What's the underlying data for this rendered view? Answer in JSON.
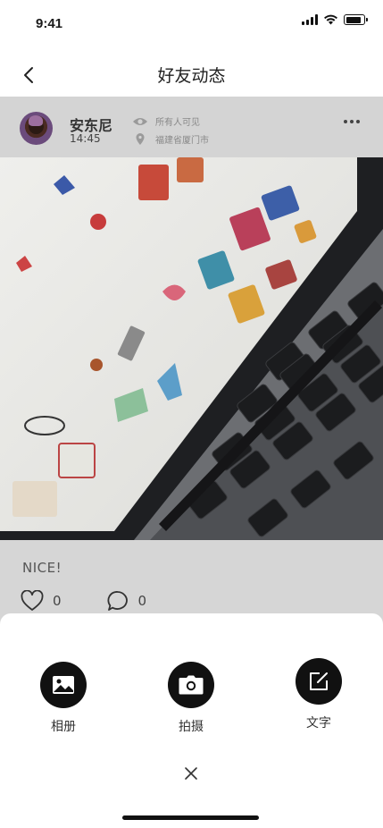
{
  "status_bar": {
    "time": "9:41",
    "battery_level": 0.85
  },
  "nav": {
    "title": "好友动态",
    "back_icon": "chevron-left-icon"
  },
  "post": {
    "author": "安东尼",
    "time": "14:45",
    "visibility": "所有人可见",
    "location": "福建省厦门市",
    "caption": "NICE!",
    "like_count": "0",
    "comment_count": "0",
    "image_description_icon": "photo"
  },
  "sheet": {
    "options": [
      {
        "label": "相册",
        "icon": "image-icon"
      },
      {
        "label": "拍摄",
        "icon": "camera-icon"
      },
      {
        "label": "文字",
        "icon": "edit-icon"
      }
    ],
    "close_icon": "close-icon"
  },
  "colors": {
    "overlay_dim": "#d6d6d6",
    "sheet_icon_bg": "#111111",
    "text_primary": "#222222"
  }
}
